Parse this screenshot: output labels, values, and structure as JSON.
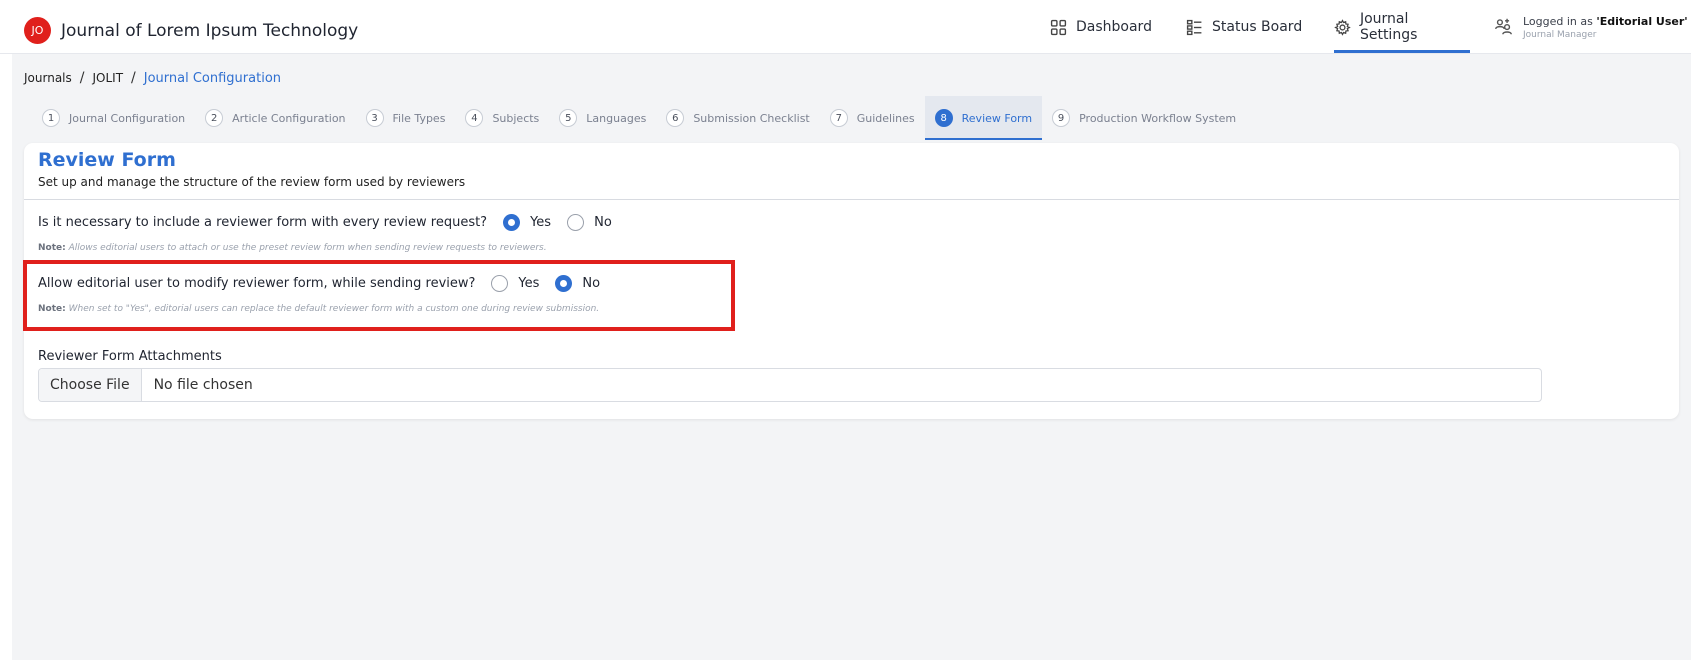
{
  "brand": {
    "logo_text": "JO",
    "title": "Journal of Lorem Ipsum Technology"
  },
  "topnav": {
    "dashboard": {
      "label": "Dashboard",
      "icon": "grid-icon"
    },
    "status_board": {
      "label": "Status Board",
      "icon": "board-icon"
    },
    "journal_settings": {
      "label": "Journal Settings",
      "icon": "gear-icon",
      "active": true
    }
  },
  "user": {
    "prefix": "Logged in as ",
    "name": "'Editorial User'",
    "role": "Journal Manager",
    "icon": "users-icon"
  },
  "breadcrumb": {
    "items": [
      "Journals",
      "JOLIT"
    ],
    "current": "Journal Configuration",
    "separator": "/"
  },
  "steps": [
    {
      "num": "1",
      "label": "Journal Configuration"
    },
    {
      "num": "2",
      "label": "Article Configuration"
    },
    {
      "num": "3",
      "label": "File Types"
    },
    {
      "num": "4",
      "label": "Subjects"
    },
    {
      "num": "5",
      "label": "Languages"
    },
    {
      "num": "6",
      "label": "Submission Checklist"
    },
    {
      "num": "7",
      "label": "Guidelines"
    },
    {
      "num": "8",
      "label": "Review Form",
      "active": true
    },
    {
      "num": "9",
      "label": "Production Workflow System"
    }
  ],
  "card": {
    "title": "Review Form",
    "subtitle": "Set up and manage the structure of the review form used by reviewers",
    "q1": {
      "question": "Is it necessary to include a reviewer form with every review request?",
      "yes": "Yes",
      "no": "No",
      "selected": "Yes",
      "note_label": "Note:",
      "note": " Allows editorial users to attach or use the preset review form when sending review requests to reviewers."
    },
    "q2": {
      "question": "Allow editorial user to modify reviewer form, while sending review?",
      "yes": "Yes",
      "no": "No",
      "selected": "No",
      "note_label": "Note:",
      "note": " When set to \"Yes\", editorial users can replace the default reviewer form with a custom one during review submission."
    },
    "attachments": {
      "label": "Reviewer Form Attachments",
      "button": "Choose File",
      "status": "No file chosen"
    }
  },
  "colors": {
    "accent": "#2f6fd0",
    "highlight": "#e0201c",
    "logo": "#e0201c"
  }
}
